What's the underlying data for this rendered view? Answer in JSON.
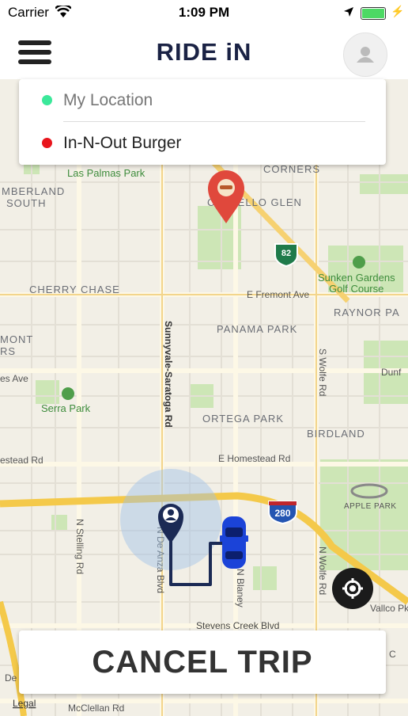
{
  "status_bar": {
    "carrier": "Carrier",
    "time": "1:09 PM"
  },
  "header": {
    "logo": "RIDE iN"
  },
  "route": {
    "origin": "My Location",
    "destination": "In-N-Out Burger",
    "origin_color": "#3be89a",
    "destination_color": "#e8141c"
  },
  "map_labels": {
    "corners": "CORNERS",
    "las_palmas": "Las Palmas Park",
    "cumberland_1": "MBERLAND",
    "cumberland_2": "SOUTH",
    "castello": "CASTELLO GLEN",
    "highway82": "82",
    "sunken_1": "Sunken Gardens",
    "sunken_2": "Golf Course",
    "cherry": "CHERRY CHASE",
    "fremont": "E Fremont Ave",
    "raynor": "RAYNOR PA",
    "panama": "PANAMA PARK",
    "sunnyvale_saratoga": "Sunnyvale-Saratoga Rd",
    "montclaire_1": "MONT",
    "montclaire_2": "RS",
    "es_ave": "es Ave",
    "wolfe_upper": "S Wolfe Rd",
    "dunford": "Dunf",
    "serra": "Serra Park",
    "ortega": "ORTEGA PARK",
    "birdland": "BIRDLAND",
    "homestead_left": "estead Rd",
    "homestead": "E Homestead Rd",
    "highway280": "280",
    "apple_park": "APPLE PARK",
    "stelling": "N Stelling Rd",
    "de_anza": "N De Anza Blvd",
    "blaney": "N Blaney",
    "wolfe_lower": "N Wolfe Rd",
    "vallco": "Vallco Pkwy",
    "stevens": "Stevens Creek Blvd",
    "de_left": "De",
    "legal": "Legal",
    "mcclellan": "McClellan Rd",
    "c_right": "C"
  },
  "buttons": {
    "cancel": "CANCEL TRIP"
  },
  "icons": {
    "menu": "hamburger-menu-icon",
    "avatar": "user-avatar-icon",
    "locate": "locate-me-icon",
    "destination_pin": "burger-pin-icon",
    "user_pin": "user-location-pin-icon",
    "car": "car-icon"
  },
  "colors": {
    "brand": "#1a2244",
    "route": "#1b2a55",
    "pin": "#e0483c"
  }
}
